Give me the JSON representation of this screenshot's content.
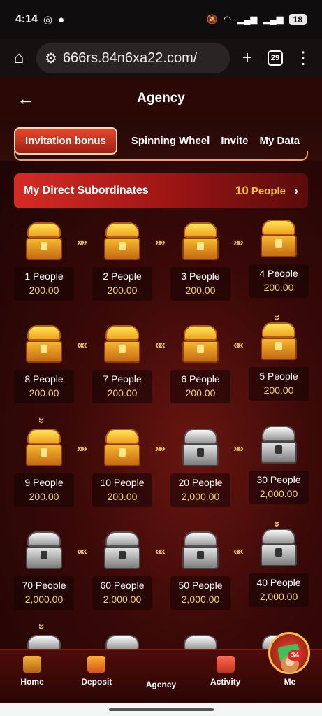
{
  "status_bar": {
    "time": "4:14",
    "battery": "18"
  },
  "browser": {
    "url": "666rs.84n6xa22.com/",
    "tab_count": "29"
  },
  "header": {
    "title": "Agency"
  },
  "tabs": [
    {
      "label": "Invitation bonus"
    },
    {
      "label": "Spinning Wheel"
    },
    {
      "label": "Invite"
    },
    {
      "label": "My Data"
    }
  ],
  "subordinates": {
    "label": "My Direct Subordinates",
    "count": "10",
    "unit": "People"
  },
  "rewards": [
    {
      "people": "1 People",
      "amount": "200.00",
      "chest": "gold"
    },
    {
      "people": "2 People",
      "amount": "200.00",
      "chest": "gold"
    },
    {
      "people": "3 People",
      "amount": "200.00",
      "chest": "gold"
    },
    {
      "people": "4 People",
      "amount": "200.00",
      "chest": "gold"
    },
    {
      "people": "5 People",
      "amount": "200.00",
      "chest": "gold"
    },
    {
      "people": "6 People",
      "amount": "200.00",
      "chest": "gold"
    },
    {
      "people": "7 People",
      "amount": "200.00",
      "chest": "gold"
    },
    {
      "people": "8 People",
      "amount": "200.00",
      "chest": "gold"
    },
    {
      "people": "9 People",
      "amount": "200.00",
      "chest": "gold"
    },
    {
      "people": "10 People",
      "amount": "200.00",
      "chest": "gold"
    },
    {
      "people": "20 People",
      "amount": "2,000.00",
      "chest": "silver"
    },
    {
      "people": "30 People",
      "amount": "2,000.00",
      "chest": "silver"
    },
    {
      "people": "40 People",
      "amount": "2,000.00",
      "chest": "silver"
    },
    {
      "people": "50 People",
      "amount": "2,000.00",
      "chest": "silver"
    },
    {
      "people": "60 People",
      "amount": "2,000.00",
      "chest": "silver"
    },
    {
      "people": "70 People",
      "amount": "2,000.00",
      "chest": "silver"
    }
  ],
  "bottom_nav": [
    {
      "label": "Home"
    },
    {
      "label": "Deposit"
    },
    {
      "label": "Agency"
    },
    {
      "label": "Activity"
    },
    {
      "label": "Me",
      "badge": "34"
    }
  ],
  "colors": {
    "accent": "#d52c25",
    "gold": "#f5c130",
    "background": "#3a0908"
  }
}
